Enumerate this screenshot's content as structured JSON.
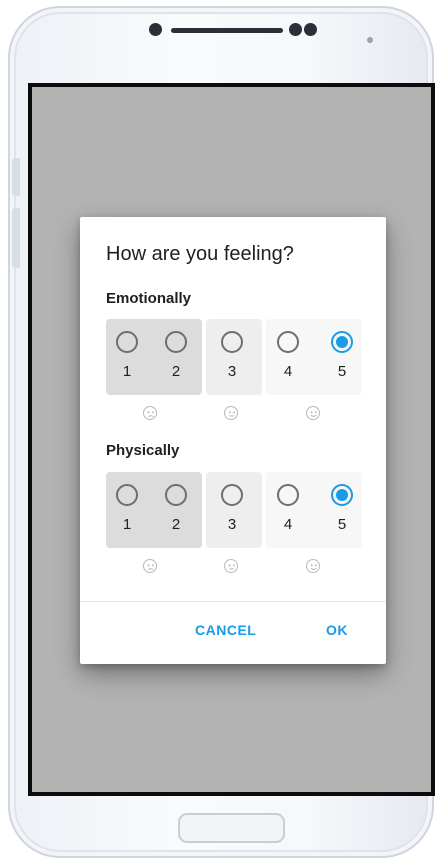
{
  "dialog": {
    "title": "How are you feeling?",
    "sections": [
      {
        "label": "Emotionally",
        "options": [
          "1",
          "2",
          "3",
          "4",
          "5"
        ],
        "selected": "5"
      },
      {
        "label": "Physically",
        "options": [
          "1",
          "2",
          "3",
          "4",
          "5"
        ],
        "selected": "5"
      }
    ],
    "faces": [
      "sad-face-icon",
      "neutral-face-icon",
      "happy-face-icon"
    ],
    "cancel_label": "CANCEL",
    "ok_label": "OK"
  },
  "colors": {
    "accent": "#1a9be6",
    "scrim": "#b3b3b3",
    "group_low": "#dcdcdc",
    "group_mid": "#eeeeee",
    "group_high": "#f7f7f7"
  }
}
